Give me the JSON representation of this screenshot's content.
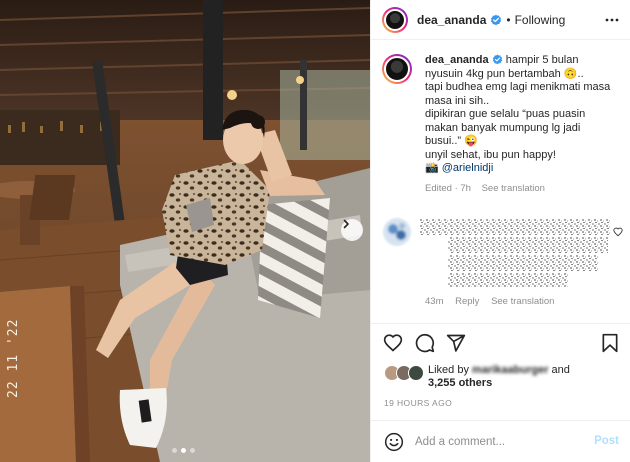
{
  "post": {
    "photo": {
      "date_stamp": "22 11 '22",
      "carousel": {
        "count": 3,
        "active_index": 1
      }
    },
    "header": {
      "username": "dea_ananda",
      "separator": "•",
      "follow_status": "Following"
    },
    "caption": {
      "username": "dea_ananda",
      "lines": [
        "hampir 5 bulan",
        "nyusuin 4kg pun bertambah 🙃..",
        "tapi budhea emg lagi menikmati masa",
        "masa ini sih..",
        "dipikiran gue selalu “puas puasin",
        "makan banyak mumpung lg jadi",
        "busui..” 😜",
        "unyil sehat, ibu pun happy!"
      ],
      "credit_icon": "📸",
      "mention": "@arielnidji",
      "edited": "Edited · 7h",
      "see_translation": "See translation"
    },
    "comment": {
      "time": "43m",
      "reply": "Reply",
      "see_translation": "See translation"
    },
    "likes": {
      "prefix": "Liked by",
      "user": "marikaaburger",
      "and_text": "and",
      "others": "3,255 others"
    },
    "timestamp": "19 HOURS AGO",
    "add_comment": {
      "placeholder": "Add a comment...",
      "post_label": "Post"
    },
    "icons": [
      "more-icon",
      "heart-icon",
      "comment-icon",
      "share-icon",
      "bookmark-icon",
      "emoji-icon",
      "verified-icon",
      "chevron-right-icon"
    ],
    "colors": {
      "accent": "#0095f6",
      "post_disabled": "#b2dffc",
      "link": "#00376b",
      "muted": "#8e8e8e"
    }
  }
}
